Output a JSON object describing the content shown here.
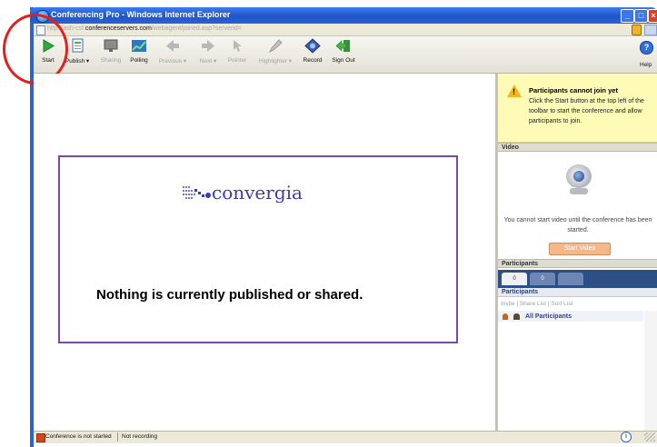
{
  "window": {
    "title": "Conferencing Pro - Windows Internet Explorer",
    "minimize_glyph": "_",
    "maximize_glyph": "□",
    "close_glyph": "×"
  },
  "address": {
    "prefix": "http://ash-csf.",
    "domain": "conferenceservers.com",
    "path": "/webagent/joined.asp?serverid="
  },
  "toolbar": {
    "items": [
      {
        "label": "Start",
        "icon": "play-icon",
        "enabled": true
      },
      {
        "label": "Publish ▾",
        "icon": "publish-icon",
        "enabled": true
      },
      {
        "label": "Sharing",
        "icon": "sharing-icon",
        "enabled": false
      },
      {
        "label": "Polling",
        "icon": "polling-icon",
        "enabled": true
      },
      {
        "label": "Previous ▾",
        "icon": "arrow-left-icon",
        "enabled": false
      },
      {
        "label": "Next ▾",
        "icon": "arrow-right-icon",
        "enabled": false
      },
      {
        "label": "Pointer",
        "icon": "pointer-icon",
        "enabled": false
      },
      {
        "label": "Highlighter ▾",
        "icon": "highlighter-icon",
        "enabled": false
      },
      {
        "label": "Record",
        "icon": "record-icon",
        "enabled": true
      },
      {
        "label": "Sign Out",
        "icon": "sign-out-icon",
        "enabled": true
      }
    ],
    "help_label": "Help",
    "help_glyph": "?"
  },
  "stage": {
    "logo_text": "convergia",
    "message": "Nothing is currently published or shared."
  },
  "warning": {
    "title": "Participants cannot join yet",
    "body": "Click the Start button at the top left of the toolbar to start the conference and allow participants to join.",
    "glyph": "!"
  },
  "video": {
    "header": "Video",
    "message": "You cannot start video until the conference has been started.",
    "start_button": "Start Video"
  },
  "participants": {
    "header": "Participants",
    "tabs": [
      {
        "label": "0"
      },
      {
        "label": "0"
      },
      {
        "label": ""
      }
    ],
    "subheader": "Participants",
    "links": "Invite  |  Share List  |  Sort List",
    "all_label": "All Participants"
  },
  "status": {
    "conference": "Conference is not started",
    "recording": "Not recording",
    "info_glyph": "i"
  },
  "colors": {
    "titlebar": "#1f55c8",
    "accent_green": "#2faa3a",
    "annotation_red": "#e0211d",
    "frame_purple": "#7a4aa8",
    "warning_yellow": "#fdfbb5"
  }
}
